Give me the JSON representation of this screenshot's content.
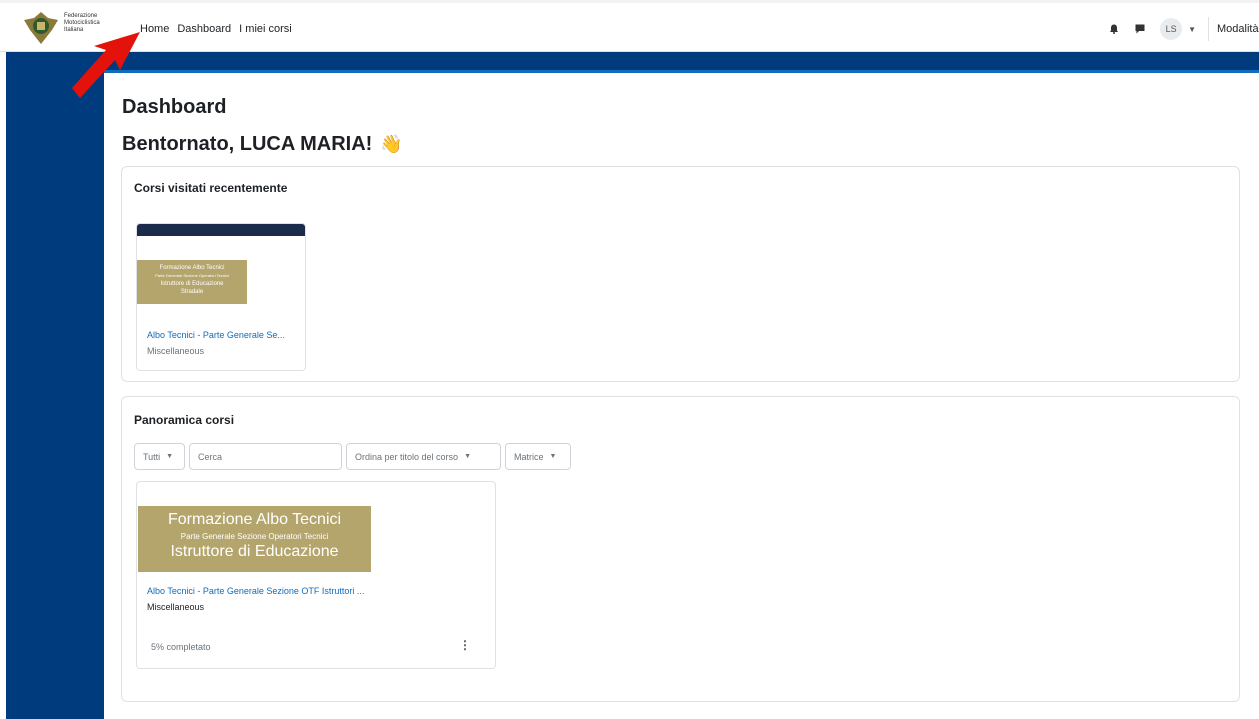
{
  "header": {
    "logo_text": [
      "Federazione",
      "Motociclistica",
      "Italiana"
    ],
    "nav": [
      {
        "label": "Home",
        "active": false
      },
      {
        "label": "Dashboard",
        "active": true
      },
      {
        "label": "I miei corsi",
        "active": false
      }
    ],
    "user_initials": "LS",
    "mode_label": "Modalità"
  },
  "icons": [
    "bell-icon",
    "chat-icon",
    "chevron-down-icon",
    "kebab-menu-icon",
    "wave-hand-icon",
    "arrow-annotation"
  ],
  "colors": {
    "brand_blue": "#003b7e",
    "accent_blue": "#0f6cbf",
    "course_image_gold": "#b4a56d",
    "annotation_red": "#e3120b"
  },
  "page": {
    "title": "Dashboard",
    "welcome": "Bentornato, LUCA MARIA!",
    "welcome_emoji": "👋"
  },
  "recent": {
    "title": "Corsi visitati recentemente",
    "course": {
      "image_lines": [
        "Formazione Albo Tecnici",
        "Parte Generale Sezione Operatori Tecnici",
        "Istruttore di Educazione",
        "Stradale"
      ],
      "name": "Albo Tecnici - Parte Generale Se...",
      "category": "Miscellaneous"
    }
  },
  "overview": {
    "title": "Panoramica corsi",
    "filter_value": "Tutti",
    "search_placeholder": "Cerca",
    "sort_value": "Ordina per titolo del corso",
    "view_value": "Matrice",
    "course": {
      "image_lines": [
        "Formazione Albo Tecnici",
        "Parte Generale Sezione Operatori Tecnici",
        "Istruttore di Educazione"
      ],
      "name": "Albo Tecnici - Parte Generale Sezione OTF Istruttori ...",
      "category": "Miscellaneous",
      "progress_text": "5% completato",
      "progress_percent": 5
    }
  }
}
